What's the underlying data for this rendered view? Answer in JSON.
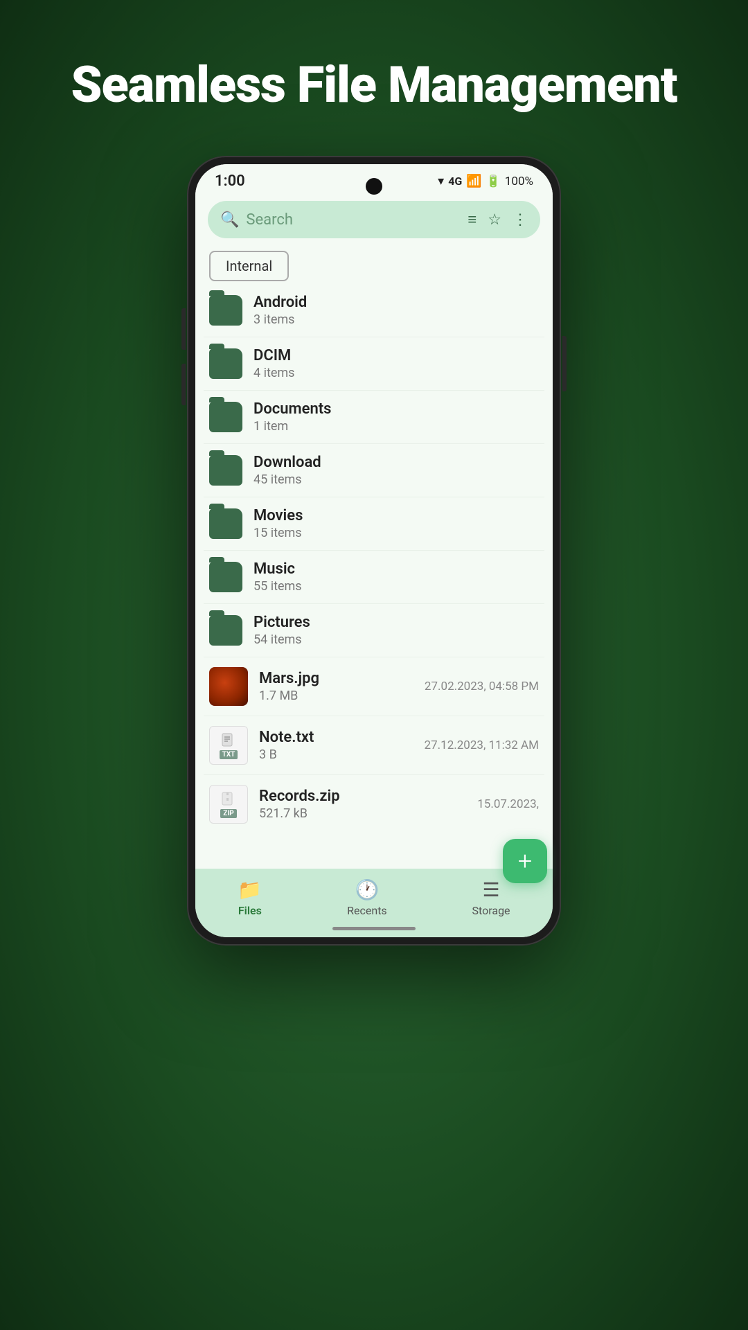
{
  "page": {
    "title": "Seamless File Management"
  },
  "status_bar": {
    "time": "1:00",
    "signal": "4G",
    "battery": "100%"
  },
  "search": {
    "placeholder": "Search"
  },
  "storage_tab": {
    "label": "Internal"
  },
  "folders": [
    {
      "name": "Android",
      "meta": "3 items"
    },
    {
      "name": "DCIM",
      "meta": "4 items"
    },
    {
      "name": "Documents",
      "meta": "1 item"
    },
    {
      "name": "Download",
      "meta": "45 items"
    },
    {
      "name": "Movies",
      "meta": "15 items"
    },
    {
      "name": "Music",
      "meta": "55 items"
    },
    {
      "name": "Pictures",
      "meta": "54 items"
    }
  ],
  "files": [
    {
      "name": "Mars.jpg",
      "meta": "1.7 MB",
      "date": "27.02.2023, 04:58 PM",
      "type": "image"
    },
    {
      "name": "Note.txt",
      "meta": "3 B",
      "date": "27.12.2023, 11:32 AM",
      "type": "txt"
    },
    {
      "name": "Records.zip",
      "meta": "521.7 kB",
      "date": "15.07.2023,",
      "type": "zip"
    }
  ],
  "nav": {
    "items": [
      {
        "label": "Files",
        "active": true
      },
      {
        "label": "Recents",
        "active": false
      },
      {
        "label": "Storage",
        "active": false
      }
    ]
  },
  "fab": {
    "label": "+"
  }
}
